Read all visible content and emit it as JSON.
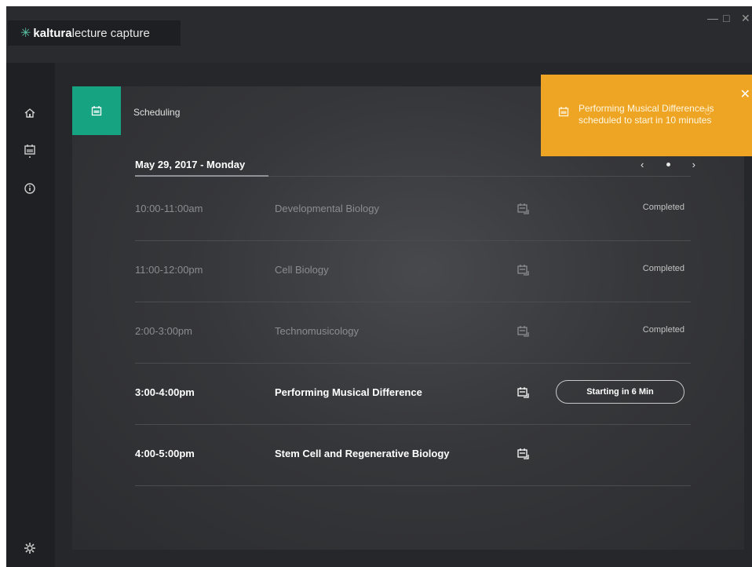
{
  "app": {
    "brand_mark": "✳",
    "brand_bold": "kaltura",
    "brand_rest": "lecture capture",
    "window_controls": {
      "minimize": "—",
      "maximize": "□",
      "close": "✕"
    }
  },
  "sidebar": {
    "items": [
      {
        "name": "home",
        "icon": "home-icon"
      },
      {
        "name": "scheduling",
        "icon": "calendar-icon"
      },
      {
        "name": "info",
        "icon": "info-icon"
      },
      {
        "name": "settings",
        "icon": "gear-icon"
      }
    ]
  },
  "panel": {
    "title": "Scheduling",
    "date": "May 29, 2017 - Monday",
    "pager": {
      "prev": "‹",
      "next": "›"
    }
  },
  "schedule": [
    {
      "time": "10:00-11:00am",
      "title": "Developmental Biology",
      "status": "Completed"
    },
    {
      "time": "11:00-12:00pm",
      "title": "Cell Biology",
      "status": "Completed"
    },
    {
      "time": "2:00-3:00pm",
      "title": "Technomusicology",
      "status": "Completed"
    },
    {
      "time": "3:00-4:00pm",
      "title": "Performing Musical Difference",
      "action": "Starting in 6 Min"
    },
    {
      "time": "4:00-5:00pm",
      "title": "Stem Cell and Regenerative Biology"
    }
  ],
  "notification": {
    "message": "Performing Musical Difference is scheduled to start in 10 minutes",
    "close": "✕",
    "spinner": "↻"
  },
  "colors": {
    "accent_green": "#16a382",
    "notification_orange": "#eea524",
    "panel_bg": "#36373a",
    "app_bg": "#26272a"
  }
}
